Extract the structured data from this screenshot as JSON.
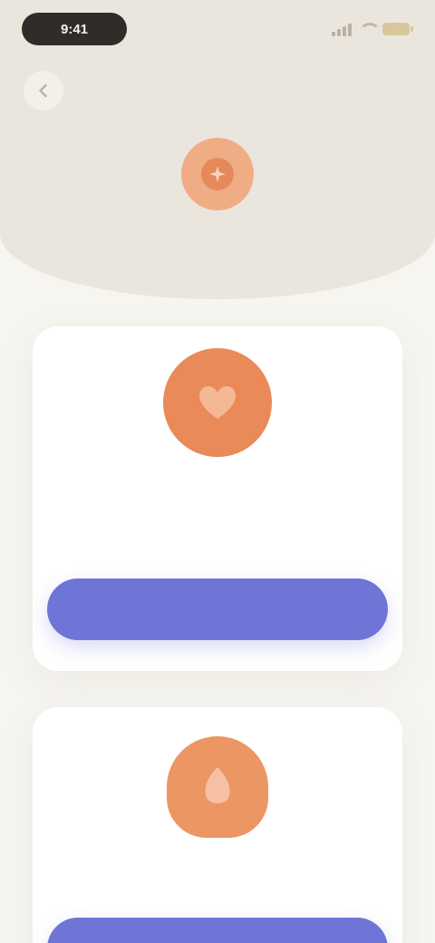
{
  "colors": {
    "background": "#f7f5f0",
    "hero": "#ebe6dd",
    "accent_orange": "#e98a58",
    "primary_button": "#6f75d6",
    "card": "#ffffff"
  },
  "status_bar": {
    "time": "9:41"
  },
  "header": {
    "back_icon": "chevron-left-icon",
    "brand_icon": "sparkle-icon",
    "title": "",
    "subtitle": ""
  },
  "cards": [
    {
      "icon": "heart-icon",
      "title": "",
      "description": "",
      "button_label": ""
    },
    {
      "icon": "leaf-icon",
      "title": "",
      "description": "",
      "button_label": ""
    }
  ]
}
